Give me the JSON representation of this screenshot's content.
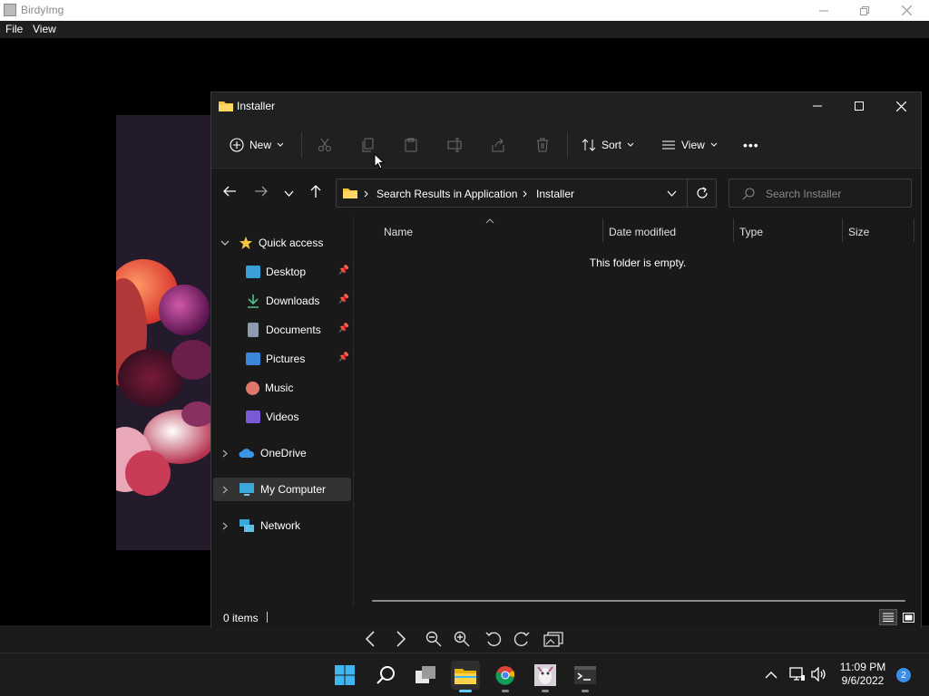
{
  "birdy": {
    "title": "BirdyImg",
    "menu": [
      "File",
      "View"
    ]
  },
  "explorer": {
    "title": "Installer",
    "commands": {
      "new": "New",
      "sort": "Sort",
      "view": "View",
      "more": "•••"
    },
    "breadcrumb": [
      "Search Results in Application",
      "Installer"
    ],
    "search_placeholder": "Search Installer",
    "nav": {
      "quick_access": "Quick access",
      "items": [
        "Desktop",
        "Downloads",
        "Documents",
        "Pictures",
        "Music",
        "Videos"
      ],
      "onedrive": "OneDrive",
      "my_computer": "My Computer",
      "network": "Network"
    },
    "columns": [
      "Name",
      "Date modified",
      "Type",
      "Size"
    ],
    "empty_message": "This folder is empty.",
    "status": "0 items"
  },
  "taskbar": {
    "time": "11:09 PM",
    "date": "9/6/2022",
    "notification_count": "2"
  },
  "colors": {
    "accent": "#60cdff",
    "folder": "#f5c542"
  }
}
